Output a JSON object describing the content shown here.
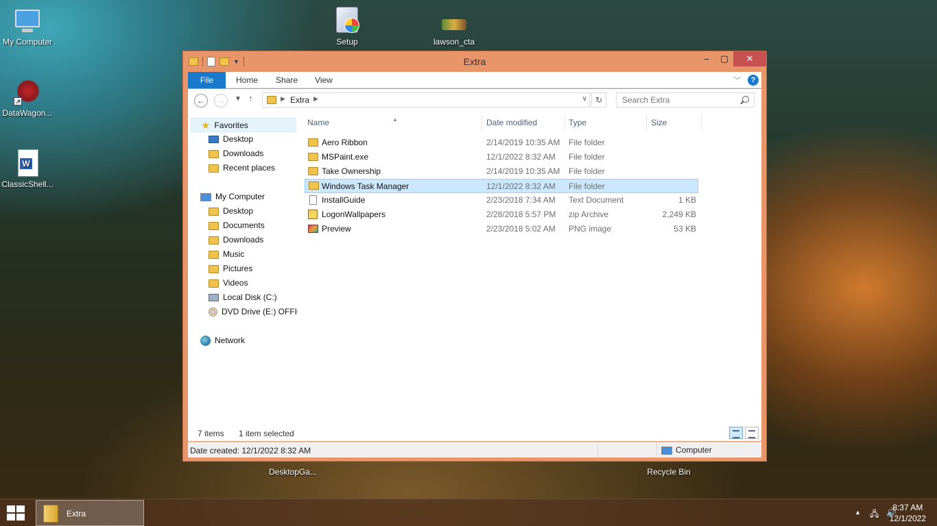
{
  "desktop": {
    "icons": {
      "my_computer": "My Computer",
      "datawagon": "DataWagon...",
      "classicshell": "ClassicShell...",
      "setup": "Setup",
      "lawson": "lawson_cta",
      "desktopga": "DesktopGa...",
      "recycle": "Recycle Bin"
    }
  },
  "window": {
    "title": "Extra",
    "controls": {
      "minimize": "–",
      "maximize": "▢",
      "close": "✕"
    },
    "ribbon": {
      "file": "File",
      "home": "Home",
      "share": "Share",
      "view": "View",
      "help": "?"
    },
    "address": {
      "path": "Extra",
      "search_placeholder": "Search Extra"
    },
    "nav": {
      "favorites": "Favorites",
      "fav_items": [
        "Desktop",
        "Downloads",
        "Recent places"
      ],
      "my_computer": "My Computer",
      "computer_items": [
        "Desktop",
        "Documents",
        "Downloads",
        "Music",
        "Pictures",
        "Videos",
        "Local Disk (C:)",
        "DVD Drive (E:) OFFIC"
      ],
      "network": "Network"
    },
    "columns": {
      "name": "Name",
      "date": "Date modified",
      "type": "Type",
      "size": "Size"
    },
    "files": [
      {
        "name": "Aero Ribbon",
        "date": "2/14/2019 10:35 AM",
        "type": "File folder",
        "size": ""
      },
      {
        "name": "MSPaint.exe",
        "date": "12/1/2022 8:32 AM",
        "type": "File folder",
        "size": ""
      },
      {
        "name": "Take Ownership",
        "date": "2/14/2019 10:35 AM",
        "type": "File folder",
        "size": ""
      },
      {
        "name": "Windows Task Manager",
        "date": "12/1/2022 8:32 AM",
        "type": "File folder",
        "size": ""
      },
      {
        "name": "InstallGuide",
        "date": "2/23/2018 7:34 AM",
        "type": "Text Document",
        "size": "1 KB"
      },
      {
        "name": "LogonWallpapers",
        "date": "2/28/2018 5:57 PM",
        "type": "zip Archive",
        "size": "2,249 KB"
      },
      {
        "name": "Preview",
        "date": "2/23/2018 5:02 AM",
        "type": "PNG image",
        "size": "53 KB"
      }
    ],
    "status": {
      "count": "7 items",
      "selected": "1 item selected"
    },
    "details": {
      "date_created": "Date created: 12/1/2022 8:32 AM",
      "location": "Computer"
    }
  },
  "taskbar": {
    "app_label": "Extra",
    "time": "8:37 AM",
    "date": "12/1/2022"
  }
}
